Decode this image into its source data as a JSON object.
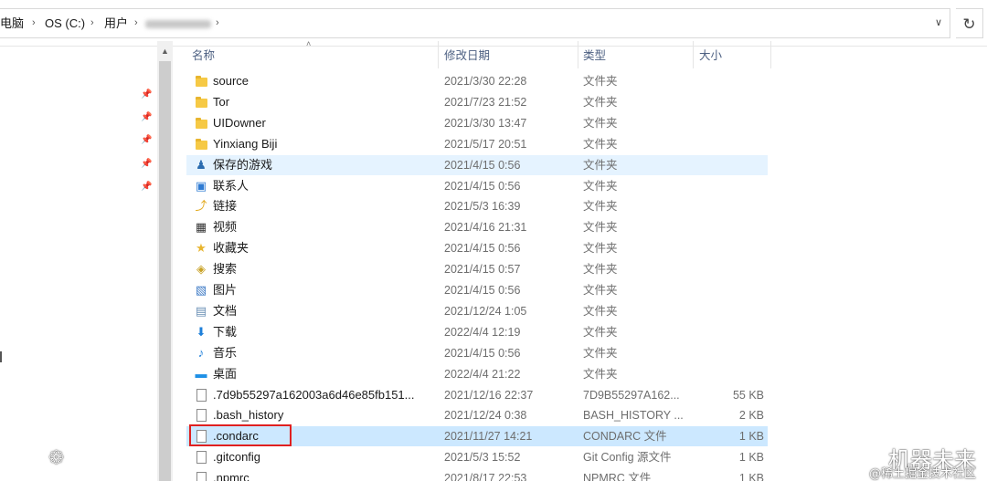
{
  "breadcrumb": {
    "items": [
      "电脑",
      "OS (C:)",
      "用户"
    ],
    "separator": "›"
  },
  "address_bar": {
    "dropdown_icon": "chevron-down-icon",
    "refresh_icon": "refresh-icon"
  },
  "columns": {
    "name": "名称",
    "date": "修改日期",
    "type": "类型",
    "size": "大小"
  },
  "files": [
    {
      "icon": "folder-icon",
      "name": "source",
      "date": "2021/3/30 22:28",
      "type": "文件夹",
      "size": "",
      "state": ""
    },
    {
      "icon": "folder-icon",
      "name": "Tor",
      "date": "2021/7/23 21:52",
      "type": "文件夹",
      "size": "",
      "state": ""
    },
    {
      "icon": "folder-icon",
      "name": "UIDowner",
      "date": "2021/3/30 13:47",
      "type": "文件夹",
      "size": "",
      "state": ""
    },
    {
      "icon": "folder-icon",
      "name": "Yinxiang Biji",
      "date": "2021/5/17 20:51",
      "type": "文件夹",
      "size": "",
      "state": ""
    },
    {
      "icon": "saved-games-icon",
      "name": "保存的游戏",
      "date": "2021/4/15 0:56",
      "type": "文件夹",
      "size": "",
      "state": "hover"
    },
    {
      "icon": "contacts-icon",
      "name": "联系人",
      "date": "2021/4/15 0:56",
      "type": "文件夹",
      "size": "",
      "state": ""
    },
    {
      "icon": "links-icon",
      "name": "链接",
      "date": "2021/5/3 16:39",
      "type": "文件夹",
      "size": "",
      "state": ""
    },
    {
      "icon": "videos-icon",
      "name": "视频",
      "date": "2021/4/16 21:31",
      "type": "文件夹",
      "size": "",
      "state": ""
    },
    {
      "icon": "favorites-icon",
      "name": "收藏夹",
      "date": "2021/4/15 0:56",
      "type": "文件夹",
      "size": "",
      "state": ""
    },
    {
      "icon": "searches-icon",
      "name": "搜索",
      "date": "2021/4/15 0:57",
      "type": "文件夹",
      "size": "",
      "state": ""
    },
    {
      "icon": "pictures-icon",
      "name": "图片",
      "date": "2021/4/15 0:56",
      "type": "文件夹",
      "size": "",
      "state": ""
    },
    {
      "icon": "documents-icon",
      "name": "文档",
      "date": "2021/12/24 1:05",
      "type": "文件夹",
      "size": "",
      "state": ""
    },
    {
      "icon": "downloads-icon",
      "name": "下载",
      "date": "2022/4/4 12:19",
      "type": "文件夹",
      "size": "",
      "state": ""
    },
    {
      "icon": "music-icon",
      "name": "音乐",
      "date": "2021/4/15 0:56",
      "type": "文件夹",
      "size": "",
      "state": ""
    },
    {
      "icon": "desktop-icon",
      "name": "桌面",
      "date": "2022/4/4 21:22",
      "type": "文件夹",
      "size": "",
      "state": ""
    },
    {
      "icon": "file-icon",
      "name": ".7d9b55297a162003a6d46e85fb151...",
      "date": "2021/12/16 22:37",
      "type": "7D9B55297A162...",
      "size": "55 KB",
      "state": ""
    },
    {
      "icon": "file-icon",
      "name": ".bash_history",
      "date": "2021/12/24 0:38",
      "type": "BASH_HISTORY ...",
      "size": "2 KB",
      "state": ""
    },
    {
      "icon": "file-icon",
      "name": ".condarc",
      "date": "2021/11/27 14:21",
      "type": "CONDARC 文件",
      "size": "1 KB",
      "state": "selected"
    },
    {
      "icon": "file-icon",
      "name": ".gitconfig",
      "date": "2021/5/3 15:52",
      "type": "Git Config 源文件",
      "size": "1 KB",
      "state": ""
    },
    {
      "icon": "file-icon",
      "name": ".npmrc",
      "date": "2021/8/17 22:53",
      "type": "NPMRC 文件",
      "size": "1 KB",
      "state": ""
    }
  ],
  "watermark": {
    "line1": "机器未来",
    "line2": "@稀土掘金技术社区"
  }
}
